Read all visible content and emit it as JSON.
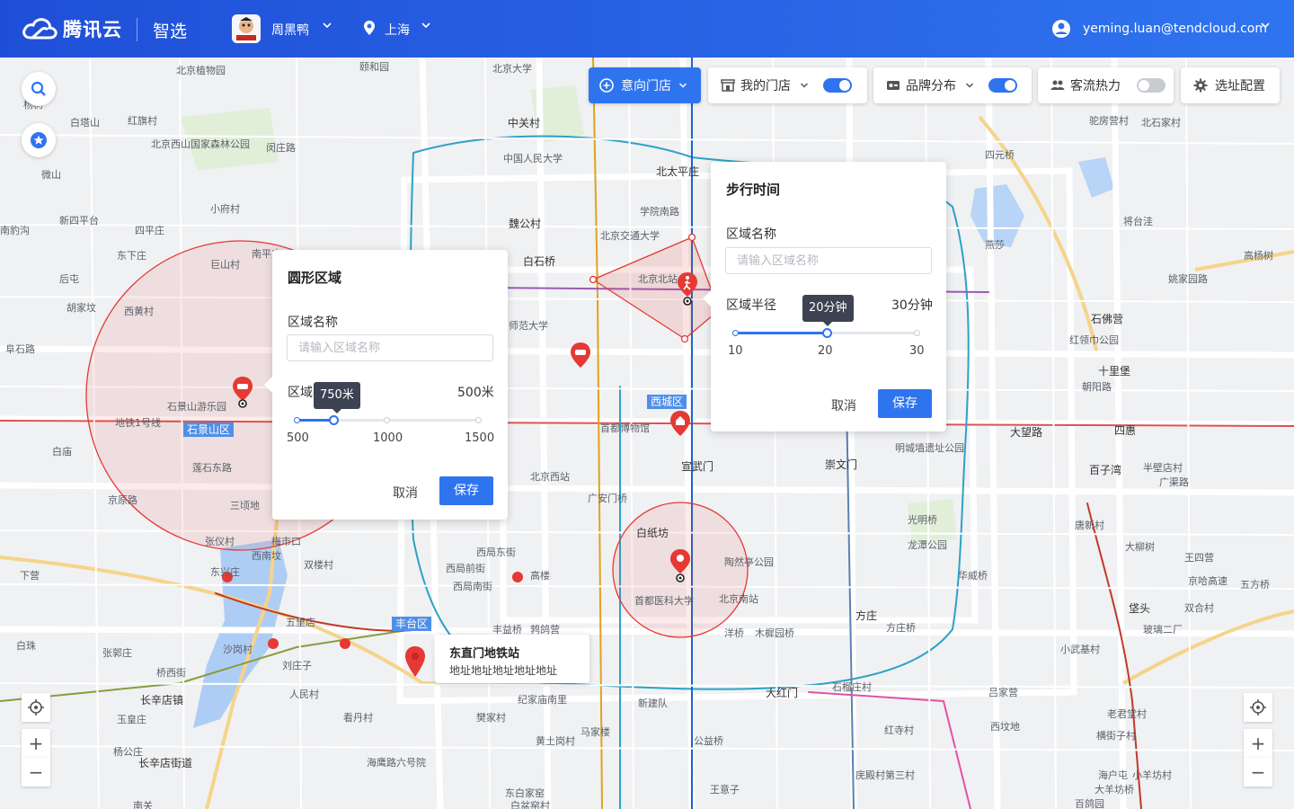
{
  "header": {
    "logo_text": "腾讯云",
    "product": "智选",
    "brand": "周黑鸭",
    "city": "上海",
    "user_email": "yeming.luan@tendcloud.com"
  },
  "toolbar": {
    "intent_store": "意向门店",
    "my_store": "我的门店",
    "my_store_on": true,
    "brand_distribution": "品牌分布",
    "brand_distribution_on": true,
    "traffic_heat": "客流热力",
    "traffic_heat_on": false,
    "site_config": "选址配置"
  },
  "circle_panel": {
    "title": "圆形区域",
    "name_label": "区域名称",
    "name_placeholder": "请输入区域名称",
    "radius_label": "区域半径",
    "radius_max_text": "500米",
    "tooltip": "750米",
    "ticks": [
      "500",
      "1000",
      "1500"
    ],
    "value_fraction": 0.2,
    "cancel": "取消",
    "save": "保存"
  },
  "walk_panel": {
    "title": "步行时间",
    "name_label": "区域名称",
    "name_placeholder": "请输入区域名称",
    "radius_label": "区域半径",
    "radius_max_text": "30分钟",
    "tooltip": "20分钟",
    "ticks": [
      "10",
      "20",
      "30"
    ],
    "value_fraction": 0.5,
    "cancel": "取消",
    "save": "保存"
  },
  "poi_card": {
    "name": "东直门地铁站",
    "address": "地址地址地址地址地址"
  },
  "map_labels": {
    "districts": [
      "石景山区",
      "西城区",
      "丰台区"
    ],
    "places": [
      "北京植物园",
      "颐和园",
      "北京大学",
      "中关村",
      "中国人民大学",
      "北太平庄",
      "学院南路",
      "北京交通大学",
      "魏公村",
      "白石桥",
      "北京北站",
      "师范大学",
      "首都博物馆",
      "北京西站",
      "广安门桥",
      "宣武门",
      "崇文门",
      "明城墙遗址公园",
      "白纸坊",
      "北京南站",
      "陶然亭公园",
      "首都医科大学",
      "西局东街",
      "西局前街",
      "西局南街",
      "高楼",
      "丰益桥",
      "鹁鸽营",
      "五里店",
      "刘庄子",
      "人民村",
      "看丹村",
      "海鹰路六号院",
      "纪家庙南里",
      "新建队",
      "樊家村",
      "马家楼",
      "黄土岗村",
      "公益桥",
      "洋桥",
      "木樨园桥",
      "方庄",
      "方庄桥",
      "大红门",
      "石榴庄村",
      "红寺村",
      "庑殿村第三村",
      "王意子",
      "东白家窑",
      "白盆窑村",
      "光明桥",
      "龙潭公园",
      "华威桥",
      "大望路",
      "四惠",
      "百子湾",
      "半壁店村",
      "广渠路",
      "唐新村",
      "大柳树",
      "王四营",
      "京哈高速",
      "五方桥",
      "垡头",
      "双合村",
      "玻璃二厂",
      "小武基村",
      "吕家营",
      "老君堂村",
      "西坟地",
      "横街子村",
      "海户屯",
      "小羊坊村",
      "大羊坊桥",
      "百鸽园",
      "石佛营",
      "红领巾公园",
      "十里堡",
      "朝阳路",
      "姚家园路",
      "高杨树",
      "将台洼",
      "燕莎",
      "四元桥",
      "驼房营村",
      "北石家村",
      "白塔山",
      "红旗村",
      "北京西山国家森林公园",
      "闵庄路",
      "小府村",
      "新四平台",
      "四平庄",
      "东下庄",
      "巨山村",
      "南平庄",
      "后屯",
      "胡家坟",
      "西黄村",
      "阜石路",
      "石景山游乐园",
      "地铁1号线",
      "白庙",
      "莲石东路",
      "京原路",
      "三顷地",
      "张仪村",
      "梅市口",
      "西南坟",
      "双楼村",
      "东兴庄",
      "下营",
      "白珠",
      "张郭庄",
      "沙岗村",
      "桥西街",
      "长辛店镇",
      "玉皇庄",
      "杨公庄",
      "长辛店街道",
      "南关",
      "微山",
      "南豹沟",
      "杨树"
    ]
  },
  "colors": {
    "primary": "#2f74ef",
    "marker_red": "#e53935",
    "area_red": "#e53935"
  }
}
